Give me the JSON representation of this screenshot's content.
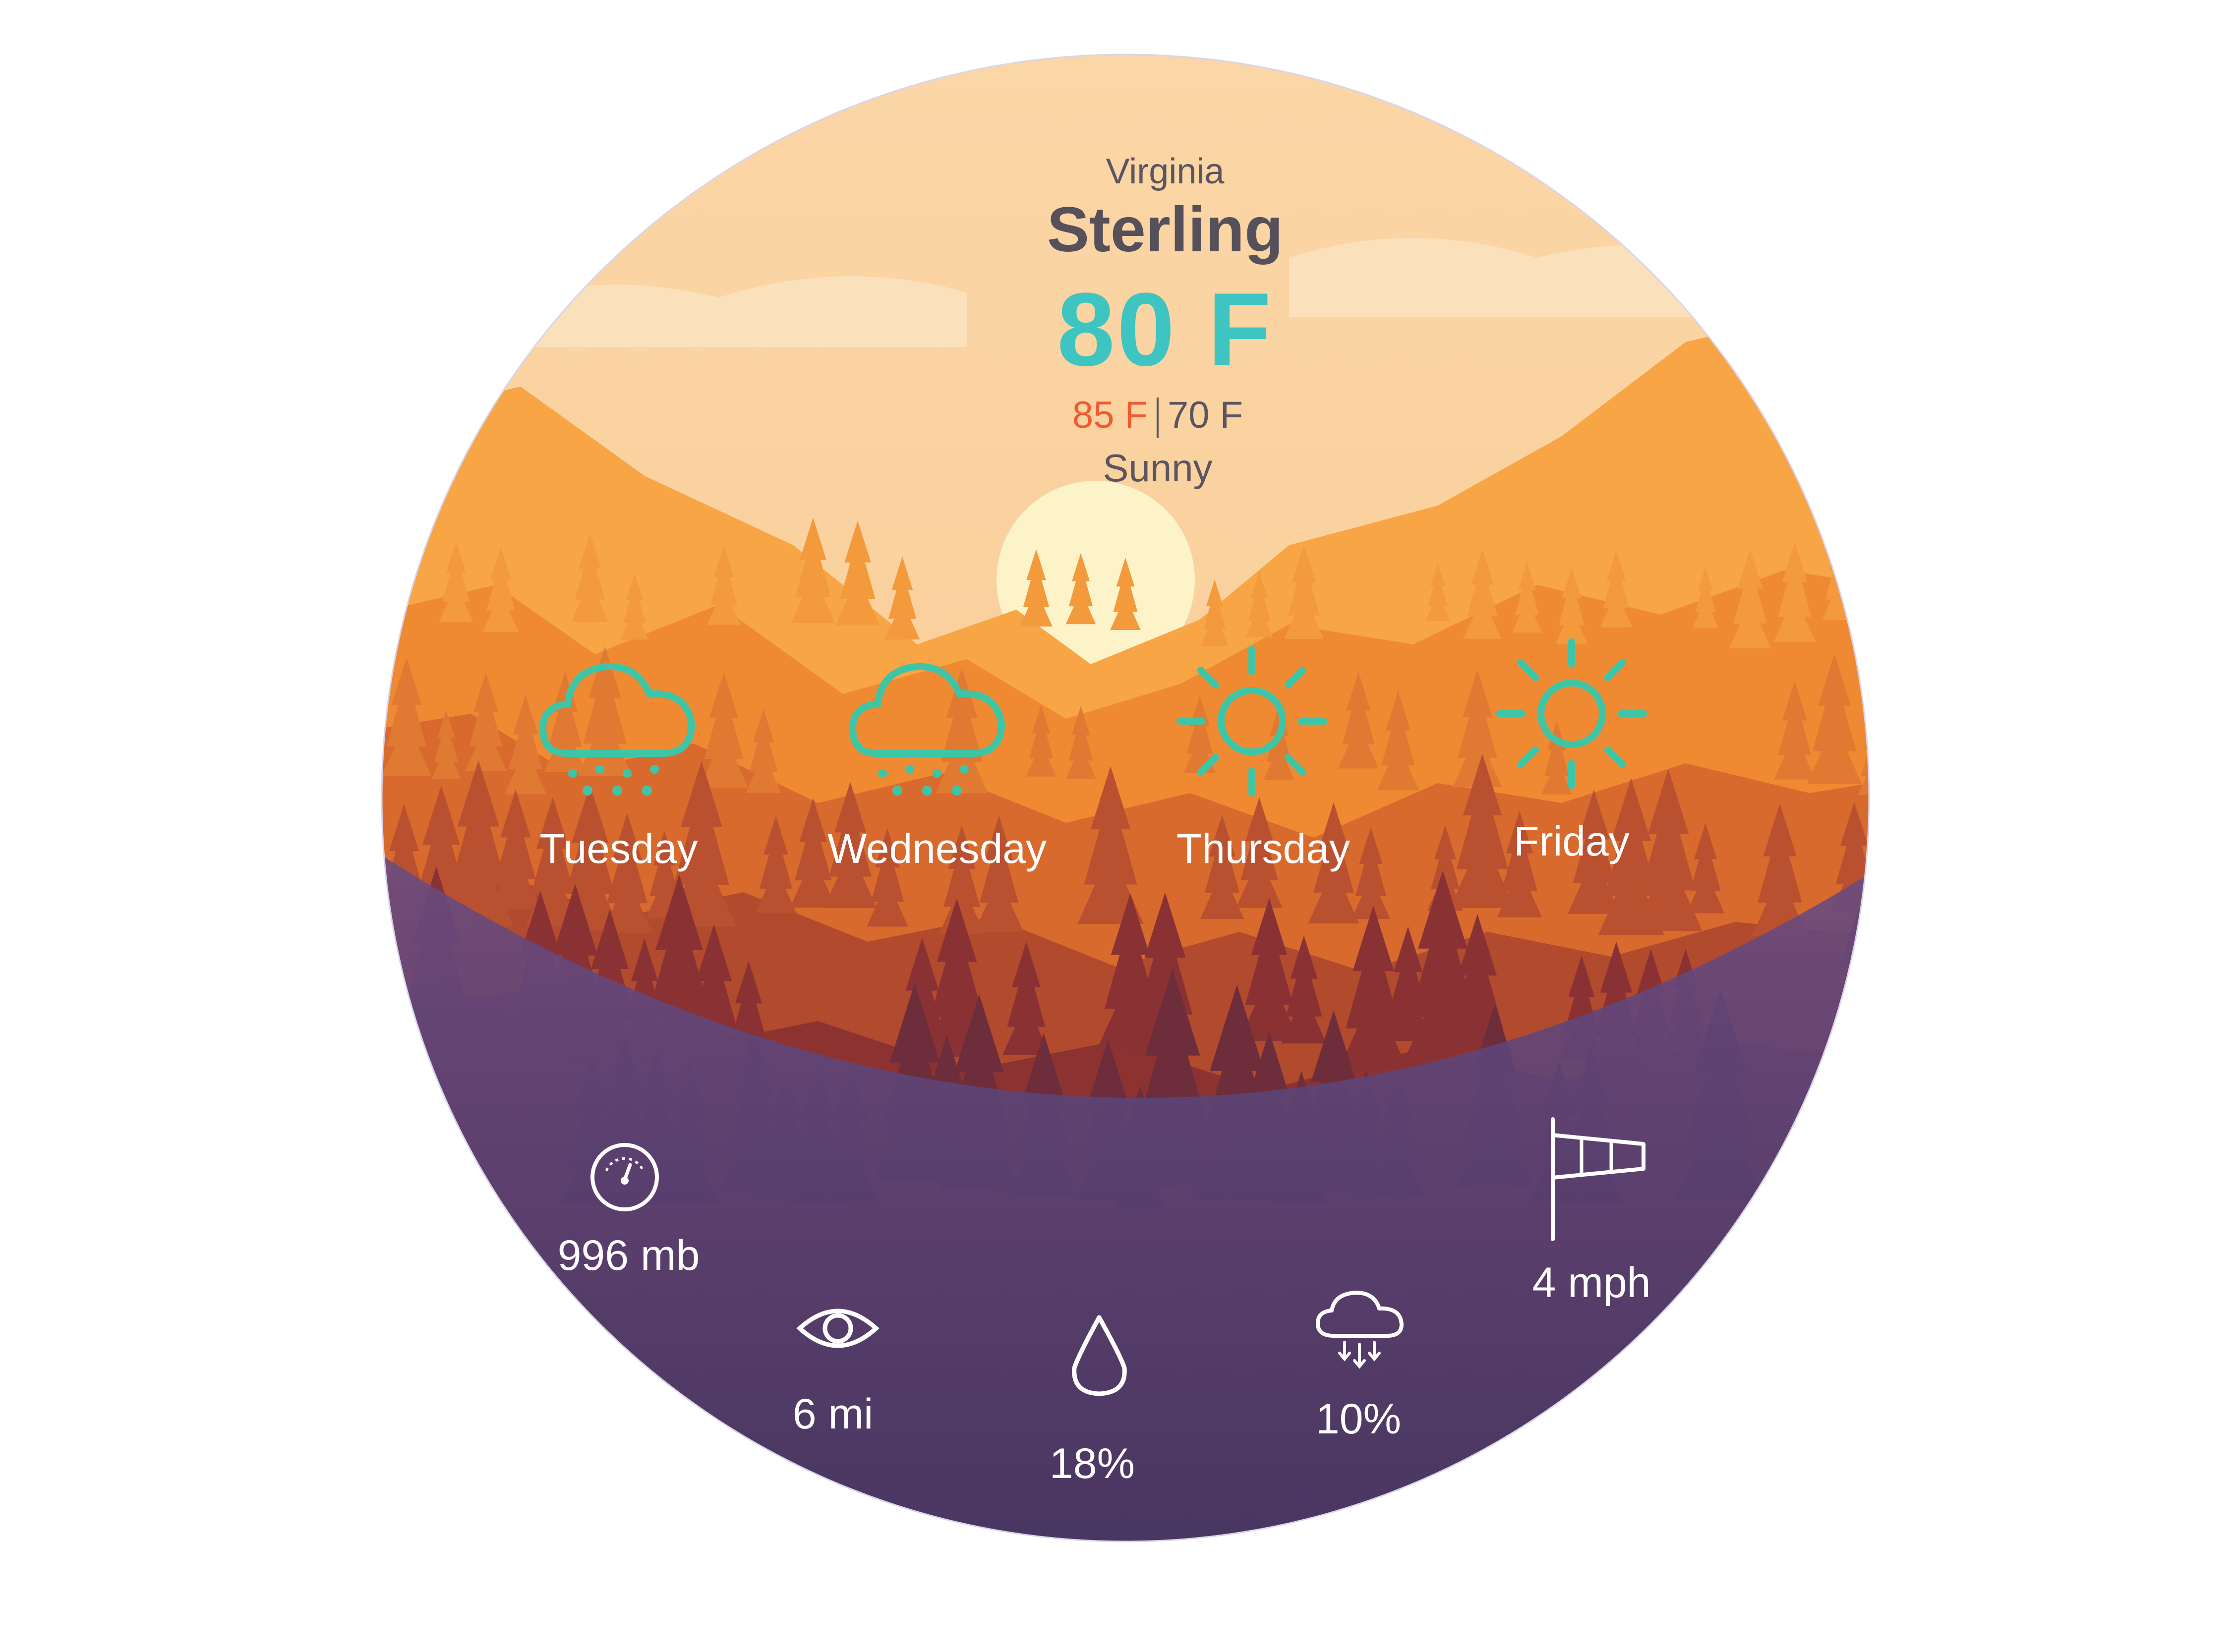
{
  "location": {
    "state": "Virginia",
    "city": "Sterling"
  },
  "current": {
    "temperature": "80 F",
    "high": "85 F",
    "low": "70 F",
    "condition": "Sunny"
  },
  "forecast": [
    {
      "day": "Tuesday",
      "icon": "rain-cloud-icon"
    },
    {
      "day": "Wednesday",
      "icon": "rain-cloud-icon"
    },
    {
      "day": "Thursday",
      "icon": "sun-icon"
    },
    {
      "day": "Friday",
      "icon": "sun-icon"
    }
  ],
  "details": {
    "pressure": {
      "value": "996 mb",
      "icon": "pressure-gauge-icon"
    },
    "visibility": {
      "value": "6 mi",
      "icon": "eye-icon"
    },
    "humidity": {
      "value": "18%",
      "icon": "water-drop-icon"
    },
    "precipitation": {
      "value": "10%",
      "icon": "precipitation-cloud-icon"
    },
    "wind": {
      "value": "4 mph",
      "icon": "windsock-icon"
    }
  },
  "colors": {
    "accent": "#3ec5c2",
    "high_temp": "#f05a33",
    "text_dark": "#5a5560",
    "sky": "#fbd3a0",
    "sun": "#fdf1c4",
    "overlay": "#4a3a6e"
  }
}
